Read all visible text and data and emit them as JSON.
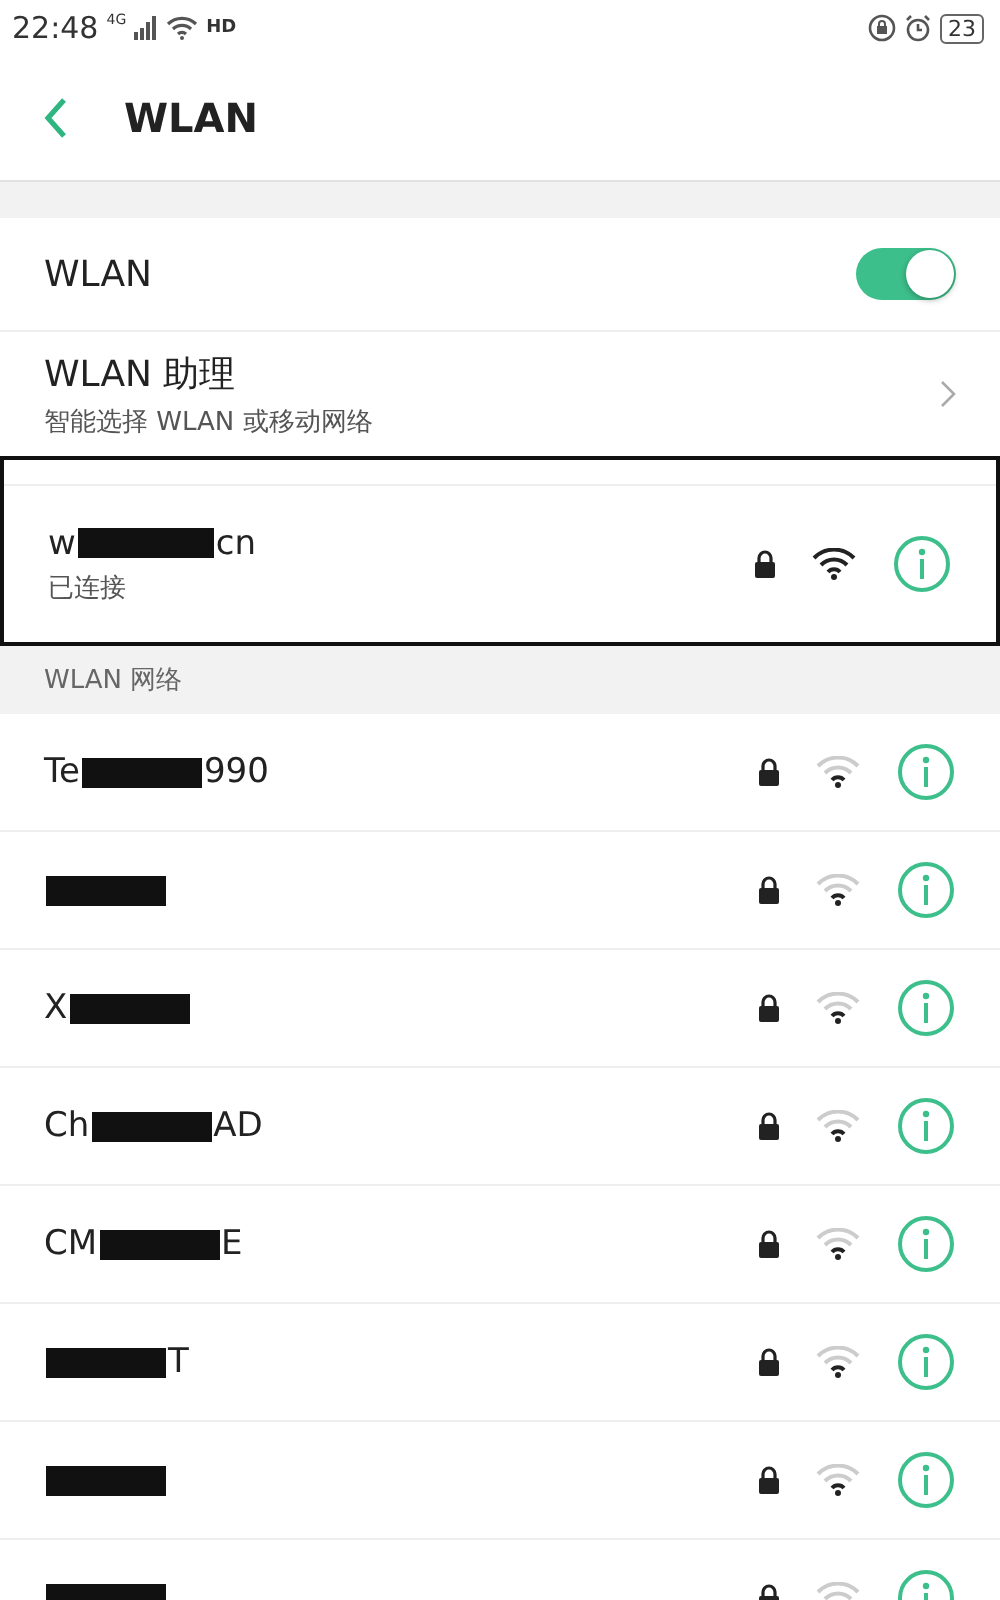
{
  "status_bar": {
    "time": "22:48",
    "network_type": "4G",
    "hd": "HD",
    "battery": "23"
  },
  "header": {
    "title": "WLAN"
  },
  "wlan_switch": {
    "label": "WLAN",
    "on": true
  },
  "assistant": {
    "title": "WLAN 助理",
    "subtitle": "智能选择 WLAN 或移动网络"
  },
  "connected": {
    "name_start": "w",
    "name_end": "cn",
    "redacted": true,
    "status": "已连接"
  },
  "section_title": "WLAN 网络",
  "networks": [
    {
      "name_start": "Te",
      "name_end": "990",
      "redacted": true
    },
    {
      "redacted": true
    },
    {
      "name_start": "X",
      "redacted": true
    },
    {
      "name_start": "Ch",
      "name_end": "AD",
      "redacted": true
    },
    {
      "name_start": "CM",
      "name_end": "E",
      "redacted": true
    },
    {
      "name_end": "T",
      "redacted": true
    },
    {
      "redacted": true
    },
    {
      "redacted": true
    }
  ]
}
